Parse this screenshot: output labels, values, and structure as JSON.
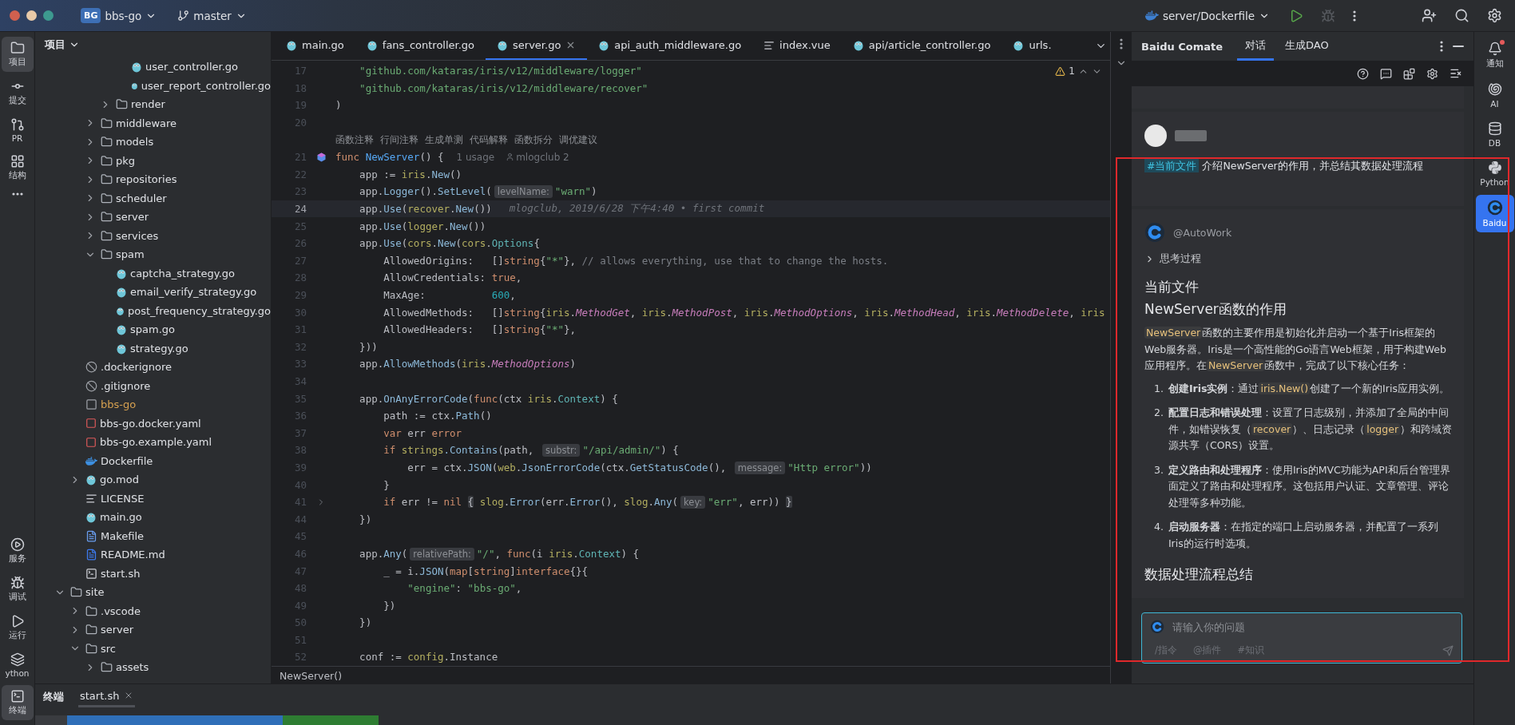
{
  "toolbar": {
    "project_badge": "BG",
    "project": "bbs-go",
    "branch": "master",
    "run_config": "server/Dockerfile",
    "debug_disabled": true
  },
  "left_strip": {
    "top": [
      {
        "label": "项目",
        "selected": true
      },
      {
        "label": "提交",
        "selected": false
      },
      {
        "label": "PR",
        "selected": false
      },
      {
        "label": "结构",
        "selected": false
      },
      {
        "selected": false
      }
    ],
    "bottom": [
      {
        "label": "服务",
        "selected": false
      },
      {
        "label": "调试",
        "selected": false
      },
      {
        "label": "运行",
        "selected": false
      },
      {
        "label": "ython",
        "selected": false
      },
      {
        "label": "终端",
        "selected": true
      }
    ]
  },
  "project_panel": {
    "title": "项目",
    "tree": [
      {
        "children": [
          {
            "children": [
              {
                "children": [
                  {
                    "children": [
                      {
                        "label": "user_controller.go",
                        "kind": "go"
                      },
                      {
                        "label": "user_report_controller.go",
                        "kind": "go"
                      }
                    ]
                  },
                  {
                    "label": "render",
                    "kind": "folder",
                    "expanded": false
                  }
                ]
              },
              {
                "label": "middleware",
                "kind": "folder",
                "expanded": false
              },
              {
                "label": "models",
                "kind": "folder",
                "expanded": false
              },
              {
                "label": "pkg",
                "kind": "folder",
                "expanded": false
              },
              {
                "label": "repositories",
                "kind": "folder",
                "expanded": false
              },
              {
                "label": "scheduler",
                "kind": "folder",
                "expanded": false
              },
              {
                "label": "server",
                "kind": "folder",
                "expanded": false
              },
              {
                "label": "services",
                "kind": "folder",
                "expanded": false
              },
              {
                "label": "spam",
                "kind": "folder",
                "expanded": true,
                "children": [
                  {
                    "label": "captcha_strategy.go",
                    "kind": "go"
                  },
                  {
                    "label": "email_verify_strategy.go",
                    "kind": "go"
                  },
                  {
                    "label": "post_frequency_strategy.go",
                    "kind": "go"
                  },
                  {
                    "label": "spam.go",
                    "kind": "go"
                  },
                  {
                    "label": "strategy.go",
                    "kind": "go"
                  }
                ]
              }
            ]
          },
          {
            "label": ".dockerignore",
            "kind": "ignore"
          },
          {
            "label": ".gitignore",
            "kind": "ignore"
          },
          {
            "label": "bbs-go",
            "kind": "binary",
            "ignored": true
          },
          {
            "label": "bbs-go.docker.yaml",
            "kind": "yaml"
          },
          {
            "label": "bbs-go.example.yaml",
            "kind": "yaml"
          },
          {
            "label": "Dockerfile",
            "kind": "docker"
          },
          {
            "label": "go.mod",
            "kind": "gomod",
            "expanded": false
          },
          {
            "label": "LICENSE",
            "kind": "license"
          },
          {
            "label": "main.go",
            "kind": "go"
          },
          {
            "label": "Makefile",
            "kind": "makefile"
          },
          {
            "label": "README.md",
            "kind": "markdown"
          },
          {
            "label": "start.sh",
            "kind": "shell"
          }
        ]
      },
      {
        "label": "site",
        "kind": "folder",
        "expanded": true,
        "children": [
          {
            "label": ".vscode",
            "kind": "folder",
            "expanded": false
          },
          {
            "label": "server",
            "kind": "folder",
            "expanded": false
          },
          {
            "label": "src",
            "kind": "folder",
            "expanded": true,
            "children": [
              {
                "label": "assets",
                "kind": "folder",
                "expanded": false
              }
            ]
          }
        ]
      }
    ]
  },
  "editor": {
    "tabs": [
      {
        "label": "main.go",
        "kind": "go",
        "selected": false
      },
      {
        "label": "fans_controller.go",
        "kind": "go",
        "selected": false
      },
      {
        "label": "server.go",
        "kind": "go",
        "selected": true
      },
      {
        "label": "api_auth_middleware.go",
        "kind": "go",
        "selected": false
      },
      {
        "label": "index.vue",
        "kind": "text",
        "selected": false
      },
      {
        "label": "api/article_controller.go",
        "kind": "go",
        "selected": false
      },
      {
        "label": "urls.",
        "kind": "go",
        "selected": false
      }
    ],
    "warnings": "1",
    "lines": [
      {
        "number": "17",
        "tokens": [
          {
            "text": "    \"github.com/kataras/iris/v12/middleware/logger\"",
            "kind": "str"
          }
        ]
      },
      {
        "number": "18",
        "tokens": [
          {
            "text": "    \"github.com/kataras/iris/v12/middleware/recover\"",
            "kind": "str"
          }
        ]
      },
      {
        "number": "19",
        "tokens": [
          {
            "text": ")",
            "kind": "plain"
          }
        ]
      },
      {
        "number": "20"
      },
      {
        "lens": [
          "函数注释",
          "行间注释",
          "生成单测",
          "代码解释",
          "函数拆分",
          "调优建议"
        ]
      },
      {
        "number": "21",
        "marker": true,
        "tokens": [
          {
            "text": "func ",
            "kind": "kw"
          },
          {
            "text": "NewServer",
            "kind": "decl"
          },
          {
            "text": "() {",
            "kind": "plain"
          },
          {
            "text": "1 usage",
            "kind": "usage"
          },
          {
            "text": "mlogclub 2",
            "kind": "author"
          }
        ]
      },
      {
        "number": "22",
        "tokens": [
          {
            "text": "    app := ",
            "kind": "plain"
          },
          {
            "text": "iris",
            "kind": "pkg"
          },
          {
            "text": ".",
            "kind": "plain"
          },
          {
            "text": "New",
            "kind": "call"
          },
          {
            "text": "()",
            "kind": "plain"
          }
        ]
      },
      {
        "number": "23",
        "tokens": [
          {
            "text": "    app.",
            "kind": "plain"
          },
          {
            "text": "Logger",
            "kind": "call"
          },
          {
            "text": "().",
            "kind": "plain"
          },
          {
            "text": "SetLevel",
            "kind": "call"
          },
          {
            "text": "(",
            "kind": "plain"
          },
          {
            "text": "levelName:",
            "kind": "hint"
          },
          {
            "text": "\"warn\"",
            "kind": "str"
          },
          {
            "text": ")",
            "kind": "plain"
          }
        ]
      },
      {
        "number": "24",
        "current": true,
        "tokens": [
          {
            "text": "    app.",
            "kind": "plain"
          },
          {
            "text": "Use",
            "kind": "call"
          },
          {
            "text": "(",
            "kind": "plain"
          },
          {
            "text": "recover",
            "kind": "pkg"
          },
          {
            "text": ".",
            "kind": "plain"
          },
          {
            "text": "New",
            "kind": "call"
          },
          {
            "text": "())",
            "kind": "plain"
          },
          {
            "text": "mlogclub, 2019/6/28 下午4:40 • first commit",
            "kind": "blame"
          }
        ]
      },
      {
        "number": "25",
        "tokens": [
          {
            "text": "    app.",
            "kind": "plain"
          },
          {
            "text": "Use",
            "kind": "call"
          },
          {
            "text": "(",
            "kind": "plain"
          },
          {
            "text": "logger",
            "kind": "pkg"
          },
          {
            "text": ".",
            "kind": "plain"
          },
          {
            "text": "New",
            "kind": "call"
          },
          {
            "text": "())",
            "kind": "plain"
          }
        ]
      },
      {
        "number": "26",
        "tokens": [
          {
            "text": "    app.",
            "kind": "plain"
          },
          {
            "text": "Use",
            "kind": "call"
          },
          {
            "text": "(",
            "kind": "plain"
          },
          {
            "text": "cors",
            "kind": "pkg"
          },
          {
            "text": ".",
            "kind": "plain"
          },
          {
            "text": "New",
            "kind": "call"
          },
          {
            "text": "(",
            "kind": "plain"
          },
          {
            "text": "cors",
            "kind": "pkg"
          },
          {
            "text": ".",
            "kind": "plain"
          },
          {
            "text": "Options",
            "kind": "type"
          },
          {
            "text": "{",
            "kind": "plain"
          }
        ]
      },
      {
        "number": "27",
        "tokens": [
          {
            "text": "        AllowedOrigins:   []",
            "kind": "plain"
          },
          {
            "text": "string",
            "kind": "kw"
          },
          {
            "text": "{",
            "kind": "plain"
          },
          {
            "text": "\"*\"",
            "kind": "str"
          },
          {
            "text": "}, ",
            "kind": "plain"
          },
          {
            "text": "// allows everything, use that to change the hosts.",
            "kind": "comment"
          }
        ]
      },
      {
        "number": "28",
        "tokens": [
          {
            "text": "        AllowCredentials: ",
            "kind": "plain"
          },
          {
            "text": "true",
            "kind": "kw"
          },
          {
            "text": ",",
            "kind": "plain"
          }
        ]
      },
      {
        "number": "29",
        "tokens": [
          {
            "text": "        MaxAge:           ",
            "kind": "plain"
          },
          {
            "text": "600",
            "kind": "num"
          },
          {
            "text": ",",
            "kind": "plain"
          }
        ]
      },
      {
        "number": "30",
        "tokens": [
          {
            "text": "        AllowedMethods:   []",
            "kind": "plain"
          },
          {
            "text": "string",
            "kind": "kw"
          },
          {
            "text": "{",
            "kind": "plain"
          },
          {
            "text": "iris",
            "kind": "pkg"
          },
          {
            "text": ".",
            "kind": "plain"
          },
          {
            "text": "MethodGet",
            "kind": "const"
          },
          {
            "text": ", ",
            "kind": "plain"
          },
          {
            "text": "iris",
            "kind": "pkg"
          },
          {
            "text": ".",
            "kind": "plain"
          },
          {
            "text": "MethodPost",
            "kind": "const"
          },
          {
            "text": ", ",
            "kind": "plain"
          },
          {
            "text": "iris",
            "kind": "pkg"
          },
          {
            "text": ".",
            "kind": "plain"
          },
          {
            "text": "MethodOptions",
            "kind": "const"
          },
          {
            "text": ", ",
            "kind": "plain"
          },
          {
            "text": "iris",
            "kind": "pkg"
          },
          {
            "text": ".",
            "kind": "plain"
          },
          {
            "text": "MethodHead",
            "kind": "const"
          },
          {
            "text": ", ",
            "kind": "plain"
          },
          {
            "text": "iris",
            "kind": "pkg"
          },
          {
            "text": ".",
            "kind": "plain"
          },
          {
            "text": "MethodDelete",
            "kind": "const"
          },
          {
            "text": ", ",
            "kind": "plain"
          },
          {
            "text": "iris",
            "kind": "pkg"
          }
        ]
      },
      {
        "number": "31",
        "tokens": [
          {
            "text": "        AllowedHeaders:   []",
            "kind": "plain"
          },
          {
            "text": "string",
            "kind": "kw"
          },
          {
            "text": "{",
            "kind": "plain"
          },
          {
            "text": "\"*\"",
            "kind": "str"
          },
          {
            "text": "},",
            "kind": "plain"
          }
        ]
      },
      {
        "number": "32",
        "tokens": [
          {
            "text": "    }))",
            "kind": "plain"
          }
        ]
      },
      {
        "number": "33",
        "tokens": [
          {
            "text": "    app.",
            "kind": "plain"
          },
          {
            "text": "AllowMethods",
            "kind": "call"
          },
          {
            "text": "(",
            "kind": "plain"
          },
          {
            "text": "iris",
            "kind": "pkg"
          },
          {
            "text": ".",
            "kind": "plain"
          },
          {
            "text": "MethodOptions",
            "kind": "const"
          },
          {
            "text": ")",
            "kind": "plain"
          }
        ]
      },
      {
        "number": "34"
      },
      {
        "number": "35",
        "tokens": [
          {
            "text": "    app.",
            "kind": "plain"
          },
          {
            "text": "OnAnyErrorCode",
            "kind": "call"
          },
          {
            "text": "(",
            "kind": "plain"
          },
          {
            "text": "func",
            "kind": "kw"
          },
          {
            "text": "(ctx ",
            "kind": "plain"
          },
          {
            "text": "iris",
            "kind": "pkg"
          },
          {
            "text": ".",
            "kind": "plain"
          },
          {
            "text": "Context",
            "kind": "type"
          },
          {
            "text": ") {",
            "kind": "plain"
          }
        ]
      },
      {
        "number": "36",
        "tokens": [
          {
            "text": "        path := ctx.",
            "kind": "plain"
          },
          {
            "text": "Path",
            "kind": "call"
          },
          {
            "text": "()",
            "kind": "plain"
          }
        ]
      },
      {
        "number": "37",
        "tokens": [
          {
            "text": "        var",
            "kind": "kw"
          },
          {
            "text": " err ",
            "kind": "plain"
          },
          {
            "text": "error",
            "kind": "kw"
          }
        ]
      },
      {
        "number": "38",
        "tokens": [
          {
            "text": "        if ",
            "kind": "kw"
          },
          {
            "text": "strings",
            "kind": "pkg"
          },
          {
            "text": ".Contains",
            "kind": "call"
          },
          {
            "text": "(path, ",
            "kind": "plain"
          },
          {
            "text": "substr:",
            "kind": "hint"
          },
          {
            "text": "\"/api/admin/\"",
            "kind": "str"
          },
          {
            "text": ") {",
            "kind": "plain"
          }
        ]
      },
      {
        "number": "39",
        "tokens": [
          {
            "text": "            err = ctx.",
            "kind": "plain"
          },
          {
            "text": "JSON",
            "kind": "call"
          },
          {
            "text": "(",
            "kind": "plain"
          },
          {
            "text": "web",
            "kind": "pkg"
          },
          {
            "text": ".",
            "kind": "plain"
          },
          {
            "text": "JsonErrorCode",
            "kind": "call"
          },
          {
            "text": "(ctx.",
            "kind": "plain"
          },
          {
            "text": "GetStatusCode",
            "kind": "call"
          },
          {
            "text": "(), ",
            "kind": "plain"
          },
          {
            "text": "message:",
            "kind": "hint"
          },
          {
            "text": "\"Http error\"",
            "kind": "str"
          },
          {
            "text": "))",
            "kind": "plain"
          }
        ]
      },
      {
        "number": "40",
        "tokens": [
          {
            "text": "        }",
            "kind": "plain"
          }
        ]
      },
      {
        "number": "41",
        "folded": true,
        "tokens": [
          {
            "text": "        if",
            "kind": "kw"
          },
          {
            "text": " err != ",
            "kind": "plain"
          },
          {
            "text": "nil ",
            "kind": "kw"
          },
          {
            "text": "{",
            "kind": "fold"
          },
          {
            "text": " slog",
            "kind": "pkg"
          },
          {
            "text": ".",
            "kind": "plain"
          },
          {
            "text": "Error",
            "kind": "call"
          },
          {
            "text": "(err.",
            "kind": "plain"
          },
          {
            "text": "Error",
            "kind": "call"
          },
          {
            "text": "(), ",
            "kind": "plain"
          },
          {
            "text": "slog",
            "kind": "pkg"
          },
          {
            "text": ".",
            "kind": "plain"
          },
          {
            "text": "Any",
            "kind": "call"
          },
          {
            "text": "(",
            "kind": "plain"
          },
          {
            "text": "key:",
            "kind": "hint"
          },
          {
            "text": "\"err\"",
            "kind": "str"
          },
          {
            "text": ", err)) ",
            "kind": "plain"
          },
          {
            "text": "}",
            "kind": "fold"
          }
        ]
      },
      {
        "number": "44",
        "tokens": [
          {
            "text": "    })",
            "kind": "plain"
          }
        ]
      },
      {
        "number": "45"
      },
      {
        "number": "46",
        "tokens": [
          {
            "text": "    app.",
            "kind": "plain"
          },
          {
            "text": "Any",
            "kind": "call"
          },
          {
            "text": "(",
            "kind": "plain"
          },
          {
            "text": "relativePath:",
            "kind": "hint"
          },
          {
            "text": "\"/\"",
            "kind": "str"
          },
          {
            "text": ", ",
            "kind": "plain"
          },
          {
            "text": "func",
            "kind": "kw"
          },
          {
            "text": "(i ",
            "kind": "plain"
          },
          {
            "text": "iris",
            "kind": "pkg"
          },
          {
            "text": ".",
            "kind": "plain"
          },
          {
            "text": "Context",
            "kind": "type"
          },
          {
            "text": ") {",
            "kind": "plain"
          }
        ]
      },
      {
        "number": "47",
        "tokens": [
          {
            "text": "        _ = i.",
            "kind": "plain"
          },
          {
            "text": "JSON",
            "kind": "call"
          },
          {
            "text": "(",
            "kind": "plain"
          },
          {
            "text": "map",
            "kind": "kw"
          },
          {
            "text": "[",
            "kind": "plain"
          },
          {
            "text": "string",
            "kind": "kw"
          },
          {
            "text": "]",
            "kind": "plain"
          },
          {
            "text": "interface",
            "kind": "kw"
          },
          {
            "text": "{}{",
            "kind": "plain"
          }
        ]
      },
      {
        "number": "48",
        "tokens": [
          {
            "text": "            \"engine\"",
            "kind": "str"
          },
          {
            "text": ": ",
            "kind": "plain"
          },
          {
            "text": "\"bbs-go\"",
            "kind": "str"
          },
          {
            "text": ",",
            "kind": "plain"
          }
        ]
      },
      {
        "number": "49",
        "tokens": [
          {
            "text": "        })",
            "kind": "plain"
          }
        ]
      },
      {
        "number": "50",
        "tokens": [
          {
            "text": "    })",
            "kind": "plain"
          }
        ]
      },
      {
        "number": "51"
      },
      {
        "number": "52",
        "tokens": [
          {
            "text": "    conf := ",
            "kind": "plain"
          },
          {
            "text": "config",
            "kind": "pkg"
          },
          {
            "text": ".Instance",
            "kind": "plain"
          }
        ]
      }
    ],
    "breadcrumb": "NewServer()"
  },
  "comate": {
    "title": "Baidu Comate",
    "tabs": [
      {
        "label": "对话",
        "selected": true
      },
      {
        "label": "生成DAO",
        "selected": false
      }
    ],
    "user_message": {
      "tag": "#当前文件",
      "text": "介绍NewServer的作用，并总结其数据处理流程"
    },
    "reply": {
      "agent": "@AutoWork",
      "thinking": {
        "label": "思考过程",
        "expanded": false
      },
      "blocks": [
        {
          "kind": "heading",
          "text": "当前文件"
        },
        {
          "kind": "heading",
          "text": "NewServer函数的作用"
        },
        {
          "kind": "paragraph",
          "segments": [
            {
              "text": "NewServer",
              "kind": "code"
            },
            {
              "text": "函数的主要作用是初始化并启动一个基于Iris框架的Web服务器。Iris是一个高性能的Go语言Web框架，用于构建Web应用程序。在",
              "kind": "text"
            },
            {
              "text": "NewServer",
              "kind": "code"
            },
            {
              "text": "函数中，完成了以下核心任务：",
              "kind": "text"
            }
          ]
        },
        {
          "kind": "list",
          "items": [
            {
              "number": "1.",
              "segments": [
                {
                  "text": "创建Iris实例",
                  "kind": "bold"
                },
                {
                  "text": "：通过",
                  "kind": "text"
                },
                {
                  "text": "iris.New()",
                  "kind": "code"
                },
                {
                  "text": "创建了一个新的Iris应用实例。",
                  "kind": "text"
                }
              ]
            },
            {
              "number": "2.",
              "segments": [
                {
                  "text": "配置日志和错误处理",
                  "kind": "bold"
                },
                {
                  "text": "：设置了日志级别，并添加了全局的中间件，如错误恢复（",
                  "kind": "text"
                },
                {
                  "text": "recover",
                  "kind": "code"
                },
                {
                  "text": "）、日志记录（",
                  "kind": "text"
                },
                {
                  "text": "logger",
                  "kind": "code"
                },
                {
                  "text": "）和跨域资源共享（CORS）设置。",
                  "kind": "text"
                }
              ]
            },
            {
              "number": "3.",
              "segments": [
                {
                  "text": "定义路由和处理程序",
                  "kind": "bold"
                },
                {
                  "text": "：使用Iris的MVC功能为API和后台管理界面定义了路由和处理程序。这包括用户认证、文章管理、评论处理等多种功能。",
                  "kind": "text"
                }
              ]
            },
            {
              "number": "4.",
              "segments": [
                {
                  "text": "启动服务器",
                  "kind": "bold"
                },
                {
                  "text": "：在指定的端口上启动服务器，并配置了一系列Iris的运行时选项。",
                  "kind": "text"
                }
              ]
            }
          ]
        },
        {
          "kind": "heading",
          "text": "数据处理流程总结"
        }
      ]
    },
    "input": {
      "placeholder": "请输入你的问题",
      "shortcuts": [
        "/指令",
        "@插件",
        "#知识"
      ]
    }
  },
  "right_strip": [
    {
      "label": "通知",
      "badge": true,
      "selected": false
    },
    {
      "label": "AI",
      "badge": false,
      "selected": false
    },
    {
      "label": "DB",
      "badge": false,
      "selected": false
    },
    {
      "label": "Python",
      "badge": false,
      "selected": false
    },
    {
      "label": "Baidu",
      "badge": false,
      "selected": true
    }
  ],
  "bottom_panel": {
    "title": "终端",
    "tabs": [
      {
        "label": "start.sh",
        "selected": true
      }
    ]
  }
}
